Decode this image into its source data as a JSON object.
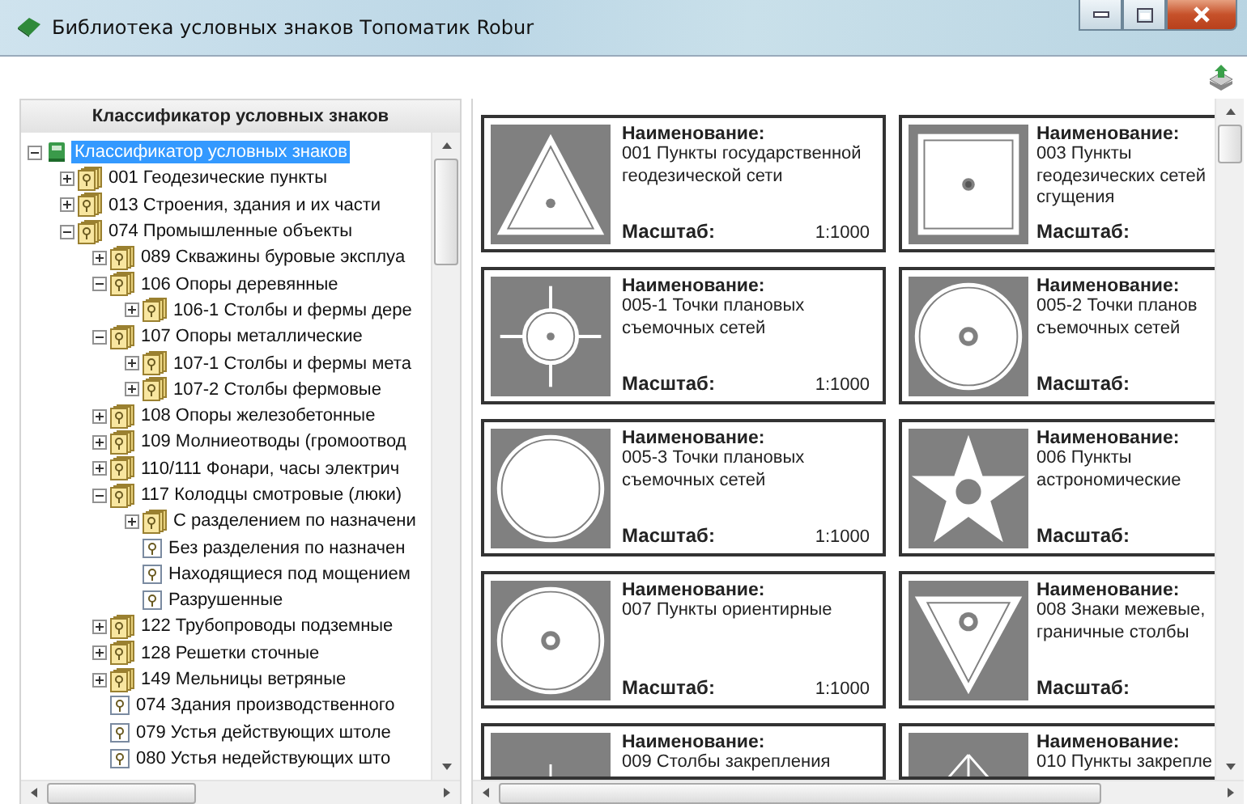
{
  "window": {
    "title": "Библиотека условных знаков Топоматик Robur"
  },
  "tree": {
    "header": "Классификатор условных знаков",
    "items": [
      {
        "label": "Классификатор условных знаков",
        "kind": "root",
        "expanded": true,
        "selected": true,
        "children": [
          {
            "label": "001 Геодезические пункты",
            "kind": "folder",
            "expanded": false,
            "selected": false
          },
          {
            "label": "013 Строения, здания и их части",
            "kind": "folder",
            "expanded": false,
            "selected": false
          },
          {
            "label": "074 Промышленные объекты",
            "kind": "folder",
            "expanded": true,
            "selected": false,
            "children": [
              {
                "label": "089 Скважины буровые эксплуа",
                "kind": "folder",
                "expanded": false,
                "selected": false
              },
              {
                "label": "106 Опоры деревянные",
                "kind": "folder",
                "expanded": true,
                "selected": false,
                "children": [
                  {
                    "label": "106-1 Столбы и фермы дере",
                    "kind": "folder",
                    "expanded": false,
                    "selected": false
                  }
                ]
              },
              {
                "label": "107 Опоры металлические",
                "kind": "folder",
                "expanded": true,
                "selected": false,
                "children": [
                  {
                    "label": "107-1 Столбы и фермы мета",
                    "kind": "folder",
                    "expanded": false,
                    "selected": false
                  },
                  {
                    "label": "107-2 Столбы фермовые",
                    "kind": "folder",
                    "expanded": false,
                    "selected": false
                  }
                ]
              },
              {
                "label": "108 Опоры железобетонные",
                "kind": "folder",
                "expanded": false,
                "selected": false
              },
              {
                "label": "109 Молниеотводы (громоотвод",
                "kind": "folder",
                "expanded": false,
                "selected": false
              },
              {
                "label": "110/111 Фонари, часы электрич",
                "kind": "folder",
                "expanded": false,
                "selected": false
              },
              {
                "label": "117 Колодцы смотровые (люки)",
                "kind": "folder",
                "expanded": true,
                "selected": false,
                "children": [
                  {
                    "label": "С разделением по назначени",
                    "kind": "folder",
                    "expanded": false,
                    "selected": false
                  },
                  {
                    "label": "Без разделения по назначен",
                    "kind": "leaf",
                    "selected": false
                  },
                  {
                    "label": "Находящиеся под мощением",
                    "kind": "leaf",
                    "selected": false
                  },
                  {
                    "label": "Разрушенные",
                    "kind": "leaf",
                    "selected": false
                  }
                ]
              },
              {
                "label": "122 Трубопроводы подземные",
                "kind": "folder",
                "expanded": false,
                "selected": false
              },
              {
                "label": "128 Решетки сточные",
                "kind": "folder",
                "expanded": false,
                "selected": false
              },
              {
                "label": "149 Мельницы ветряные",
                "kind": "folder",
                "expanded": false,
                "selected": false
              },
              {
                "label": "074 Здания производственного",
                "kind": "leaf",
                "selected": false
              },
              {
                "label": "079 Устья действующих штоле",
                "kind": "leaf",
                "selected": false
              },
              {
                "label": "080 Устья недействующих што",
                "kind": "leaf",
                "selected": false
              }
            ]
          }
        ]
      }
    ]
  },
  "cards": [
    {
      "kind": "triangle",
      "name_label": "Наименование:",
      "name": "001 Пункты государственной геодезической сети",
      "scale_label": "Масштаб:",
      "scale": "1:1000"
    },
    {
      "kind": "square",
      "name_label": "Наименование:",
      "name": "003 Пункты геодезических сетей сгущения",
      "scale_label": "Масштаб:"
    },
    {
      "kind": "crosscircle",
      "name_label": "Наименование:",
      "name": "005-1 Точки плановых съемочных сетей",
      "scale_label": "Масштаб:",
      "scale": "1:1000"
    },
    {
      "kind": "circledot",
      "name_label": "Наименование:",
      "name": "005-2 Точки планов съемочных сетей",
      "scale_label": "Масштаб:"
    },
    {
      "kind": "circle",
      "name_label": "Наименование:",
      "name": "005-3 Точки плановых съемочных сетей",
      "scale_label": "Масштаб:",
      "scale": "1:1000"
    },
    {
      "kind": "star",
      "name_label": "Наименование:",
      "name": "006 Пункты астрономические",
      "scale_label": "Масштаб:"
    },
    {
      "kind": "circledot",
      "name_label": "Наименование:",
      "name": "007 Пункты ориентирные",
      "scale_label": "Масштаб:",
      "scale": "1:1000"
    },
    {
      "kind": "invtriangle",
      "name_label": "Наименование:",
      "name": "008 Знаки межевые, граничные столбы",
      "scale_label": "Масштаб:"
    },
    {
      "kind": "line",
      "name_label": "Наименование:",
      "name": "009 Столбы закрепления"
    },
    {
      "kind": "arrow",
      "name_label": "Наименование:",
      "name": "010 Пункты закрепле"
    }
  ]
}
